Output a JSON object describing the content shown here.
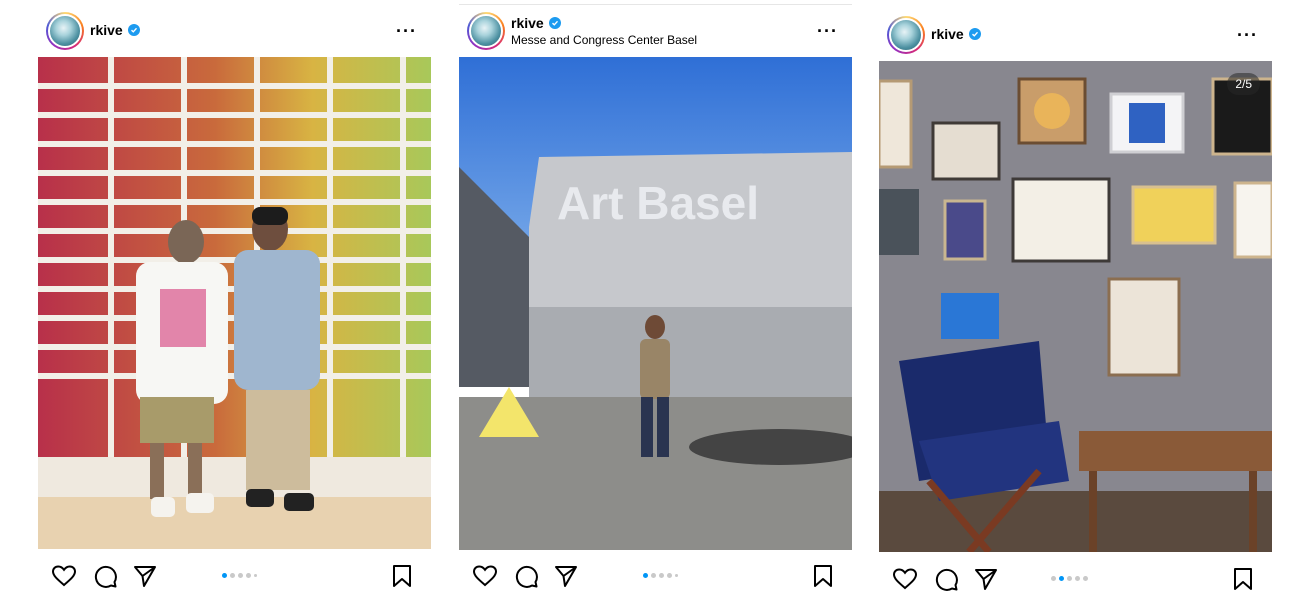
{
  "posts": [
    {
      "username": "rkive",
      "location": "",
      "counter": "",
      "photo_description": "",
      "active_slide": 1,
      "slide_count": 5
    },
    {
      "username": "rkive",
      "location": "Messe and Congress Center Basel",
      "counter": "",
      "photo_text": "Art Basel",
      "active_slide": 1,
      "slide_count": 5
    },
    {
      "username": "rkive",
      "location": "",
      "counter": "2/5",
      "active_slide": 2,
      "slide_count": 5
    }
  ],
  "icons": {
    "verified": "verified-badge-icon",
    "more": "more-options-icon",
    "like": "heart-icon",
    "comment": "comment-icon",
    "share": "send-icon",
    "save": "bookmark-icon"
  },
  "colors": {
    "verified": "#1d9bf0",
    "active_dot": "#0095f6",
    "inactive_dot": "#c9c9c9"
  }
}
